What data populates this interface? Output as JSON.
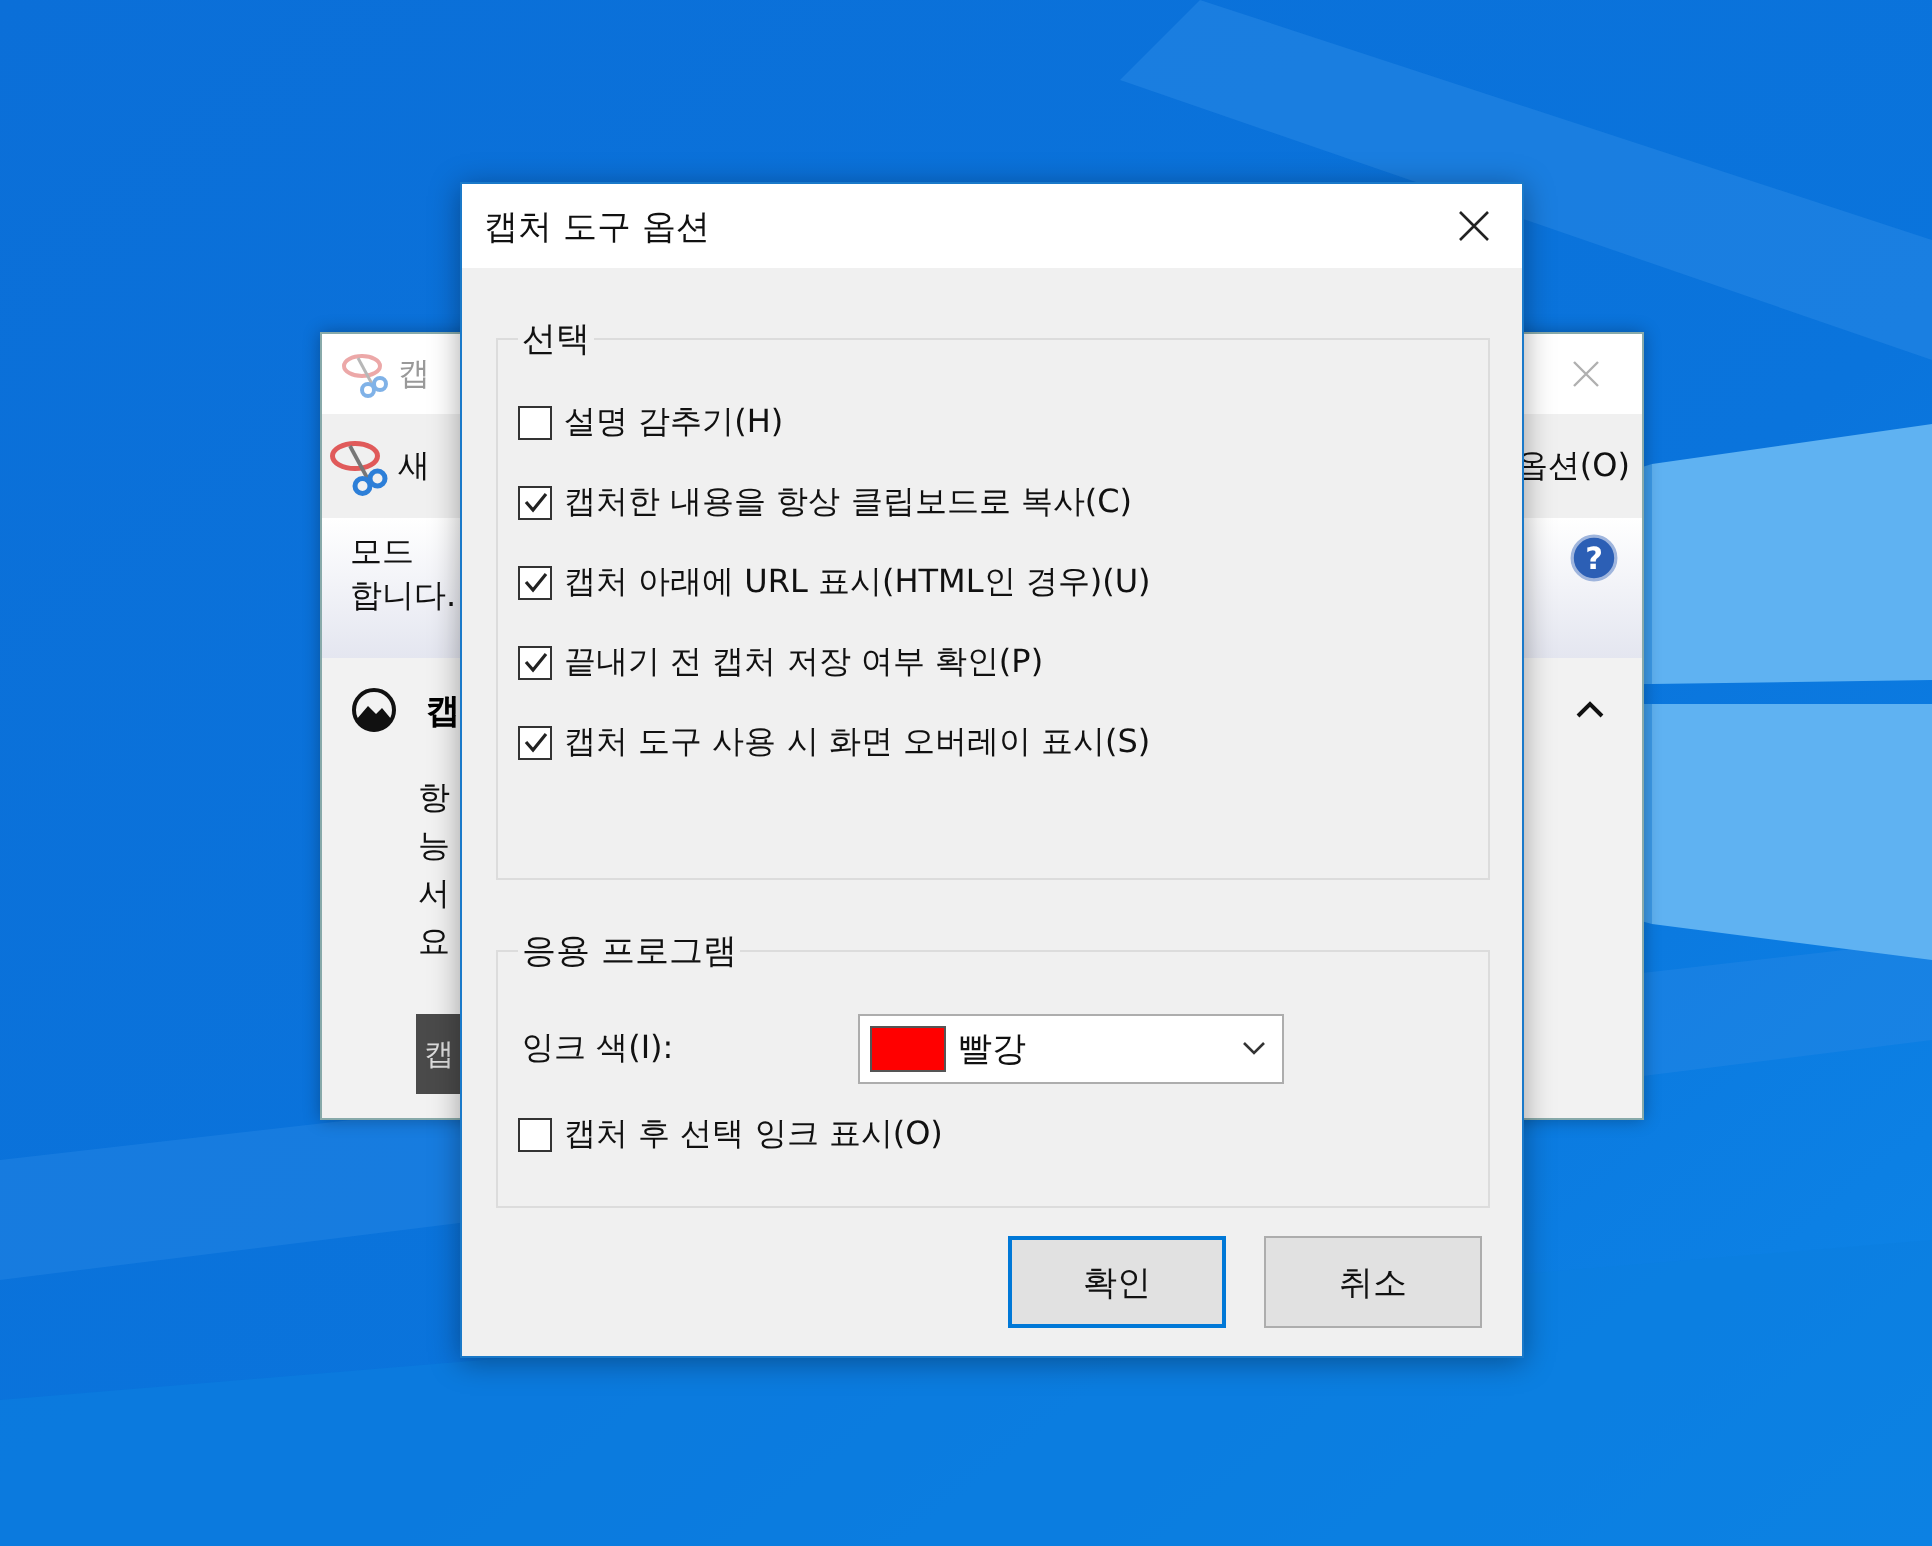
{
  "background_window": {
    "title": "캡",
    "toolbar_left": "새",
    "toolbar_right": "옵션(O)",
    "info_lines": [
      "모드",
      "합니다."
    ],
    "section_title": "캡",
    "body_lines": [
      "항",
      "능",
      "서",
      "요"
    ],
    "button": "캡",
    "help": "?"
  },
  "dialog": {
    "title": "캡처 도구 옵션",
    "groups": [
      {
        "title": "선택",
        "items": [
          {
            "kind": "checkbox",
            "label": "설명 감추기(H)",
            "checked": false
          },
          {
            "kind": "checkbox",
            "label": "캡처한 내용을 항상 클립보드로 복사(C)",
            "checked": true
          },
          {
            "kind": "checkbox",
            "label": "캡처 아래에 URL 표시(HTML인 경우)(U)",
            "checked": true
          },
          {
            "kind": "checkbox",
            "label": "끝내기 전 캡처 저장 여부 확인(P)",
            "checked": true
          },
          {
            "kind": "checkbox",
            "label": "캡처 도구 사용 시 화면 오버레이 표시(S)",
            "checked": true
          }
        ]
      },
      {
        "title": "응용 프로그램",
        "items": [
          {
            "kind": "dropdown",
            "label": "잉크 색(I):",
            "value": "빨강",
            "color": "#ff0000"
          },
          {
            "kind": "checkbox",
            "label": "캡처 후 선택 잉크 표시(O)",
            "checked": false
          }
        ]
      }
    ],
    "buttons": [
      {
        "label": "확인",
        "default": true
      },
      {
        "label": "취소",
        "default": false
      }
    ]
  }
}
